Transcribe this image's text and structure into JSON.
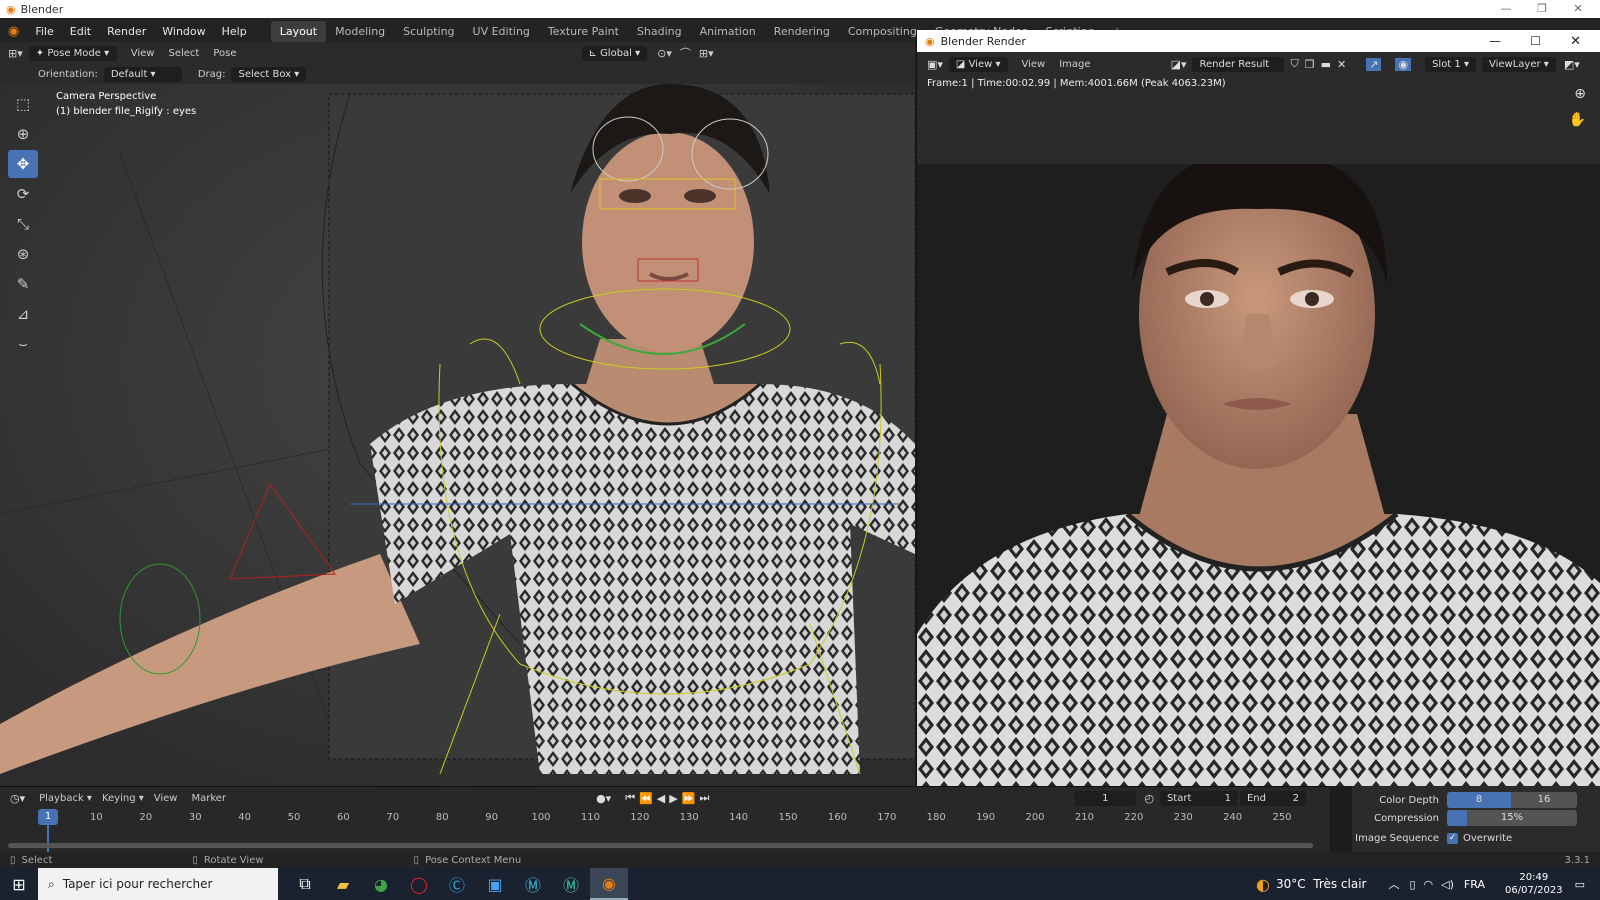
{
  "window_title": "Blender",
  "menus": [
    "File",
    "Edit",
    "Render",
    "Window",
    "Help"
  ],
  "workspaces": [
    "Layout",
    "Modeling",
    "Sculpting",
    "UV Editing",
    "Texture Paint",
    "Shading",
    "Animation",
    "Rendering",
    "Compositing",
    "Geometry Nodes",
    "Scripting"
  ],
  "active_workspace": "Layout",
  "viewport_header": {
    "mode": "Pose Mode",
    "items": [
      "View",
      "Select",
      "Pose"
    ],
    "transform": "Global"
  },
  "tool_header": {
    "orientation_label": "Orientation:",
    "orientation_value": "Default",
    "drag_label": "Drag:",
    "drag_value": "Select Box"
  },
  "viewport_overlay": {
    "line1": "Camera Perspective",
    "line2": "(1) blender file_Rigify : eyes"
  },
  "tools": [
    "select-box-icon",
    "cursor-icon",
    "move-icon",
    "rotate-icon",
    "scale-icon",
    "transform-icon",
    "annotate-icon",
    "measure-icon",
    "pose-relax-icon"
  ],
  "render_window": {
    "title": "Blender Render",
    "menus": [
      "View",
      "View",
      "Image"
    ],
    "image_name": "Render Result",
    "slot": "Slot 1",
    "view_layer": "ViewLayer",
    "info": "Frame:1 | Time:00:02.99 | Mem:4001.66M (Peak 4063.23M)"
  },
  "timeline": {
    "menus": [
      "Playback",
      "Keying",
      "View",
      "Marker"
    ],
    "current_frame": "1",
    "start_label": "Start",
    "start": "1",
    "end_label": "End",
    "end": "2",
    "ticks": [
      "1",
      "10",
      "20",
      "30",
      "40",
      "50",
      "60",
      "70",
      "80",
      "90",
      "100",
      "110",
      "120",
      "130",
      "140",
      "150",
      "160",
      "170",
      "180",
      "190",
      "200",
      "210",
      "220",
      "230",
      "240",
      "250"
    ]
  },
  "output_props": {
    "color_depth_label": "Color Depth",
    "depth_a": "8",
    "depth_b": "16",
    "compression_label": "Compression",
    "compression": "15%",
    "image_sequence_label": "Image Sequence",
    "overwrite_label": "Overwrite"
  },
  "version": "3.3.1",
  "statusbar": {
    "select": "Select",
    "rotate": "Rotate View",
    "context": "Pose Context Menu"
  },
  "taskbar": {
    "search_placeholder": "Taper ici pour rechercher",
    "weather": "30°C  Très clair",
    "lang": "FRA",
    "time": "20:49",
    "date": "06/07/2023"
  }
}
